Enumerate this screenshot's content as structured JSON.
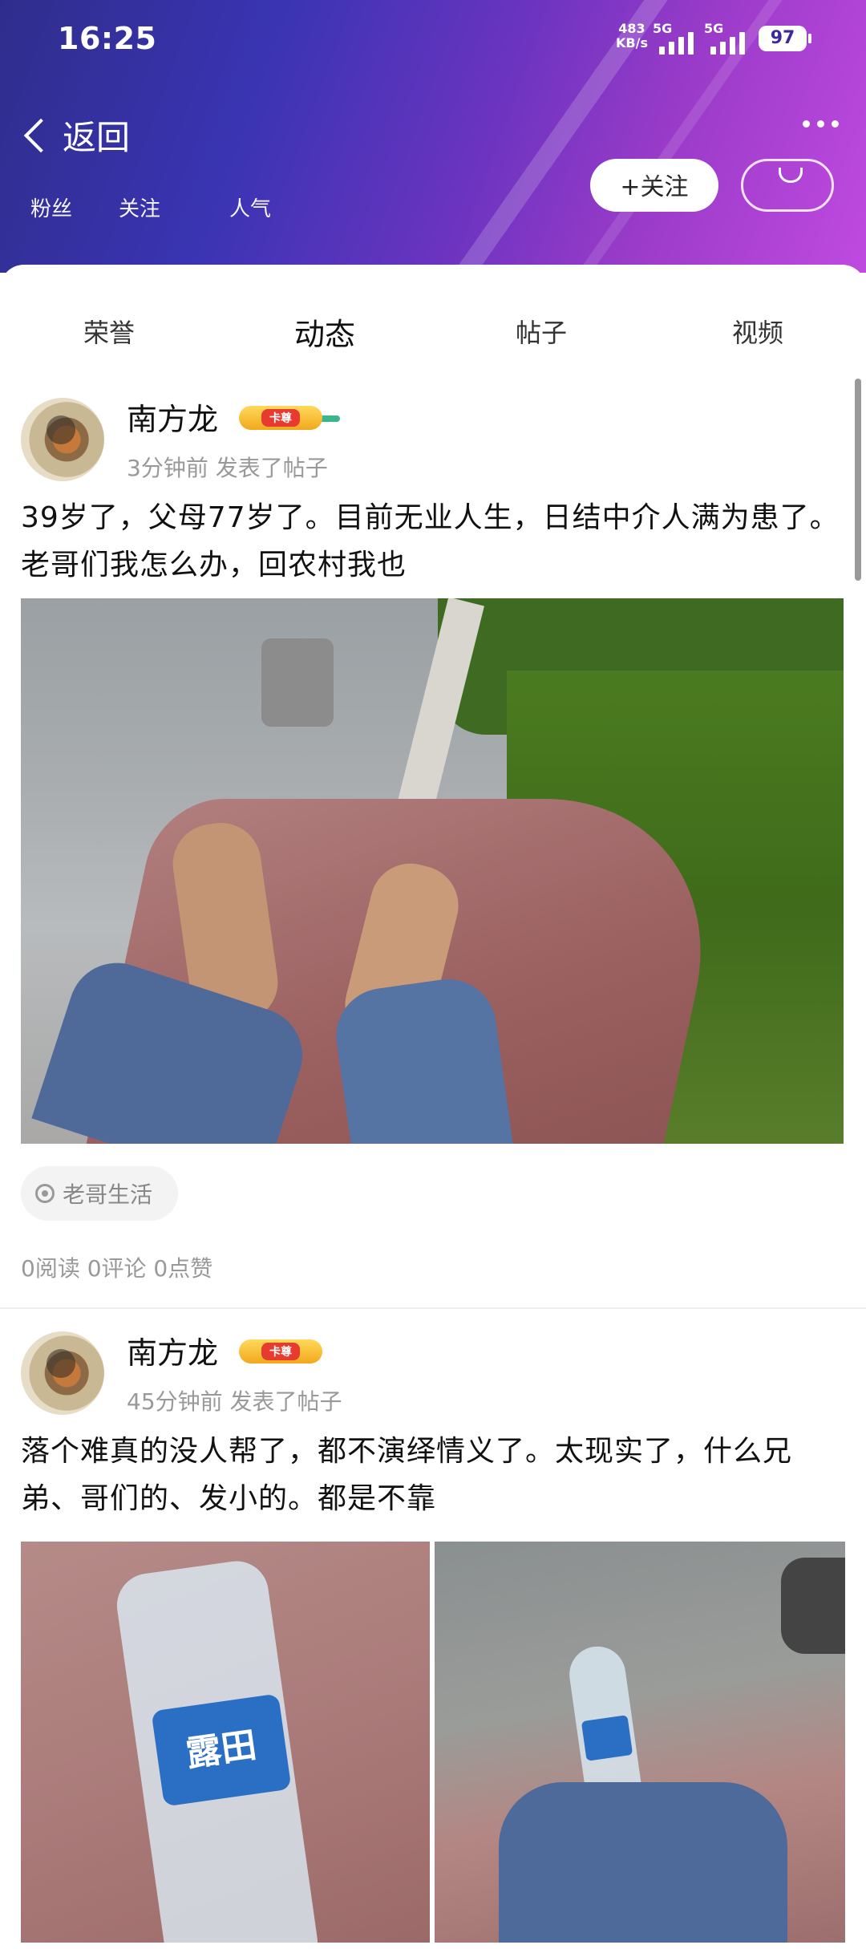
{
  "status_bar": {
    "time": "16:25",
    "net_speed_value": "483",
    "net_speed_unit": "KB/s",
    "sim1_label": "5G",
    "sim2_label": "5G",
    "battery": "97"
  },
  "header": {
    "back_label": "返回",
    "stats": [
      "粉丝",
      "关注",
      "人气"
    ],
    "follow_label": "+关注"
  },
  "tabs": [
    {
      "label": "荣誉",
      "active": false
    },
    {
      "label": "动态",
      "active": true
    },
    {
      "label": "帖子",
      "active": false
    },
    {
      "label": "视频",
      "active": false
    }
  ],
  "posts": [
    {
      "author": "南方龙",
      "badge": "卡尊",
      "meta": "3分钟前  发表了帖子",
      "text": "39岁了，父母77岁了。目前无业人生，日结中介人满为患了。老哥们我怎么办，回农村我也",
      "topic": "老哥生活",
      "stats": "0阅读  0评论  0点赞"
    },
    {
      "author": "南方龙",
      "badge": "卡尊",
      "meta": "45分钟前  发表了帖子",
      "text": "落个难真的没人帮了，都不演绎情义了。太现实了，什么兄弟、哥们的、发小的。都是不靠",
      "bottle_brand": "露田"
    }
  ],
  "colors": {
    "accent": "#3cb58c",
    "header_start": "#2f2d8c",
    "header_end": "#c04ae0"
  }
}
